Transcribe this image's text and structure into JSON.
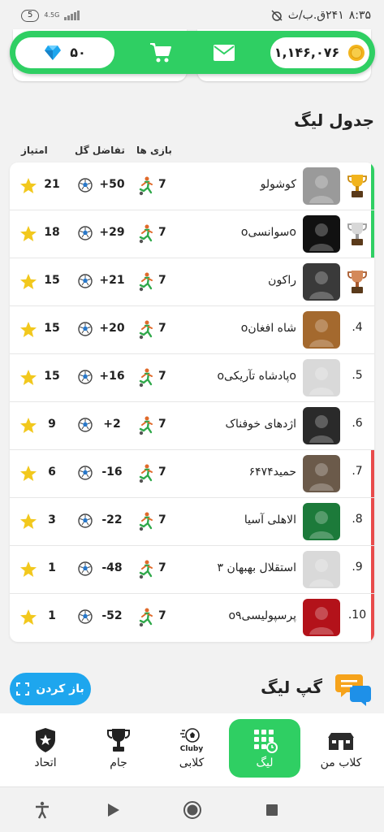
{
  "status_bar": {
    "time": "۸:۳۵",
    "date": "۲۴۱ق.ب/ث",
    "battery": "5",
    "network": "4.5G"
  },
  "header": {
    "diamonds": "۵۰",
    "coins": "۱,۱۴۶,۰۷۶",
    "icons": [
      "diamond-icon",
      "cart-icon",
      "mail-icon",
      "coin-icon"
    ]
  },
  "league_table": {
    "title": "جدول لیگ",
    "columns": {
      "games": "بازی ها",
      "goal_diff": "تفاضل گل",
      "points": "امتیاز"
    },
    "rows": [
      {
        "rank": "",
        "trophy": "gold",
        "team": "کوشولو",
        "games": "7",
        "gd": "+50",
        "pts": "21",
        "edge": "green",
        "avatar": "#9a9a9a"
      },
      {
        "rank": "",
        "trophy": "silver",
        "team": "oسوانسیo",
        "games": "7",
        "gd": "+29",
        "pts": "18",
        "edge": "green",
        "avatar": "#111111"
      },
      {
        "rank": "",
        "trophy": "bronze",
        "team": "راکون",
        "games": "7",
        "gd": "+21",
        "pts": "15",
        "edge": "",
        "avatar": "#3a3a3a"
      },
      {
        "rank": ".4",
        "trophy": "",
        "team": "شاه افغانo",
        "games": "7",
        "gd": "+20",
        "pts": "15",
        "edge": "",
        "avatar": "#a4692e"
      },
      {
        "rank": ".5",
        "trophy": "",
        "team": "oپادشاه تآریکیo",
        "games": "7",
        "gd": "+16",
        "pts": "15",
        "edge": "",
        "avatar": "#d9d9d9"
      },
      {
        "rank": ".6",
        "trophy": "",
        "team": "اژدهای خوفناک",
        "games": "7",
        "gd": "+2",
        "pts": "9",
        "edge": "",
        "avatar": "#2a2a2a"
      },
      {
        "rank": ".7",
        "trophy": "",
        "team": "حمید۶۴۷۴",
        "games": "7",
        "gd": "-16",
        "pts": "6",
        "edge": "red",
        "avatar": "#6b5a4a"
      },
      {
        "rank": ".8",
        "trophy": "",
        "team": "الاهلی آسیا",
        "games": "7",
        "gd": "-22",
        "pts": "3",
        "edge": "red",
        "avatar": "#1c7a3a"
      },
      {
        "rank": ".9",
        "trophy": "",
        "team": "استقلال بهبهان ۳",
        "games": "7",
        "gd": "-48",
        "pts": "1",
        "edge": "red",
        "avatar": "#d9d9d9"
      },
      {
        "rank": ".10",
        "trophy": "",
        "team": "پرسپولیسیo۹",
        "games": "7",
        "gd": "-52",
        "pts": "1",
        "edge": "red",
        "avatar": "#b3121a"
      }
    ]
  },
  "chat": {
    "title": "گپ لیگ",
    "open_button": "باز کردن"
  },
  "bottom_nav": {
    "items": [
      {
        "label": "کلاب من",
        "icon": "club-building-icon",
        "active": false
      },
      {
        "label": "لیگ",
        "icon": "league-grid-icon",
        "active": true
      },
      {
        "label": "کلابی",
        "icon": "cluby-ball-icon",
        "active": false
      },
      {
        "label": "جام",
        "icon": "trophy-icon",
        "active": false
      },
      {
        "label": "اتحاد",
        "icon": "shield-star-icon",
        "active": false
      }
    ]
  },
  "colors": {
    "accent_green": "#2fcf63",
    "accent_blue": "#1ea6ee",
    "promote_edge": "#2fcf63",
    "relegate_edge": "#e84b4b",
    "star": "#f2c81d"
  }
}
